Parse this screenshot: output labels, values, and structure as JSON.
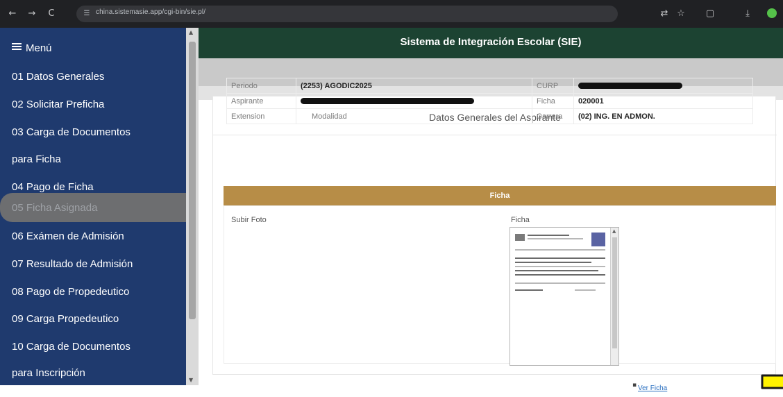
{
  "browser": {
    "url": "china.sistemasie.app/cgi-bin/sie.pl/",
    "nav_back": "←",
    "nav_forward": "→",
    "nav_reload": "C"
  },
  "sidebar": {
    "menu_label": "Menú",
    "items": [
      {
        "label": "01 Datos Generales"
      },
      {
        "label": "02 Solicitar Preficha"
      },
      {
        "label": "03 Carga de Documentos"
      },
      {
        "label": "para Ficha"
      },
      {
        "label": "04 Pago de Ficha"
      },
      {
        "label": "05 Ficha Asignada"
      },
      {
        "label": "06 Exámen de Admisión"
      },
      {
        "label": "07 Resultado de Admisión"
      },
      {
        "label": "08 Pago de Propedeutico"
      },
      {
        "label": "09 Carga Propedeutico"
      },
      {
        "label": "10 Carga de Documentos"
      },
      {
        "label": "para Inscripción"
      }
    ]
  },
  "header": {
    "title": "Sistema de Integración Escolar (SIE)"
  },
  "card": {
    "title": "Datos Generales del Aspirante",
    "periodo_label": "Periodo",
    "periodo_value": "(2253) AGODIC2025",
    "curp_label": "CURP",
    "aspirante_label": "Aspirante",
    "ficha_label": "Ficha",
    "ficha_value": "020001",
    "extension_label": "Extension",
    "modalidad_label": "Modalidad",
    "carrera_label": "Carrera",
    "carrera_value": "(02) ING. EN ADMON."
  },
  "ficha_section": {
    "bar_label": "Ficha",
    "subir_foto_label": "Subir Foto",
    "ficha_label": "Ficha",
    "ver_ficha_link": "Ver Ficha"
  },
  "colors": {
    "sidebar": "#1f3a6e",
    "header": "#1c4332",
    "ficha_bar": "#b78d47",
    "arrow": "#fff200"
  }
}
